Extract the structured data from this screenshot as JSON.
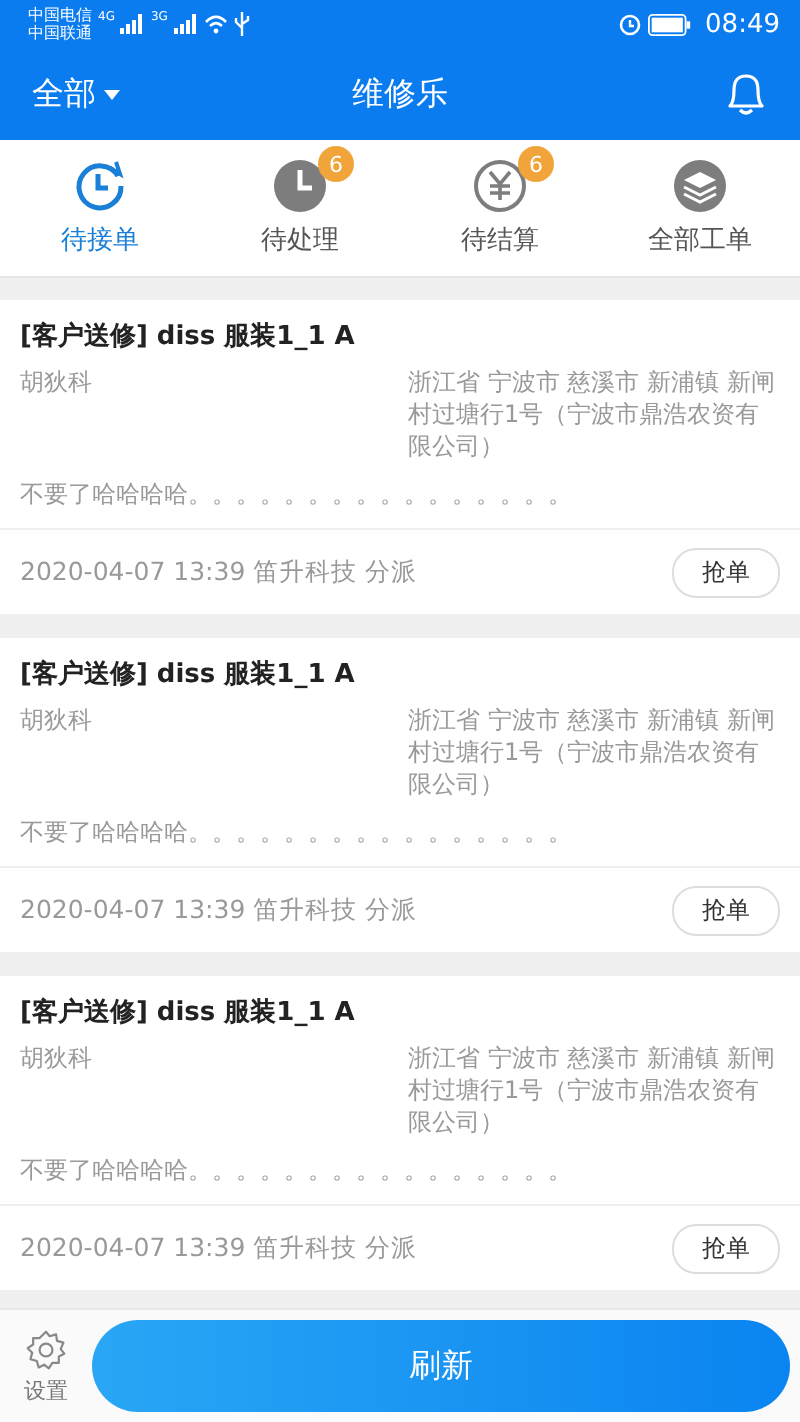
{
  "status_bar": {
    "carriers": [
      "中国电信",
      "中国联通"
    ],
    "networks": [
      "4G",
      "3G"
    ],
    "time": "08:49"
  },
  "header": {
    "filter": "全部",
    "title": "维修乐"
  },
  "tabs": [
    {
      "label": "待接单",
      "kind": "clock",
      "selected": true
    },
    {
      "label": "待处理",
      "kind": "pie",
      "badge": "6",
      "selected": false
    },
    {
      "label": "待结算",
      "kind": "yen",
      "badge": "6",
      "selected": false
    },
    {
      "label": "全部工单",
      "kind": "layers",
      "selected": false
    }
  ],
  "orders": [
    {
      "title": "[客户送修] diss 服装1_1 A",
      "customer": "胡狄科",
      "address": "浙江省 宁波市 慈溪市 新浦镇 新闸村过塘行1号（宁波市鼎浩农资有限公司）",
      "note": "不要了哈哈哈哈。。。。。。。。。。。。。。。。",
      "footer": "2020-04-07 13:39 笛升科技 分派",
      "action": "抢单"
    },
    {
      "title": "[客户送修] diss 服装1_1 A",
      "customer": "胡狄科",
      "address": "浙江省 宁波市 慈溪市 新浦镇 新闸村过塘行1号（宁波市鼎浩农资有限公司）",
      "note": "不要了哈哈哈哈。。。。。。。。。。。。。。。。",
      "footer": "2020-04-07 13:39 笛升科技 分派",
      "action": "抢单"
    },
    {
      "title": "[客户送修] diss 服装1_1 A",
      "customer": "胡狄科",
      "address": "浙江省 宁波市 慈溪市 新浦镇 新闸村过塘行1号（宁波市鼎浩农资有限公司）",
      "note": "不要了哈哈哈哈。。。。。。。。。。。。。。。。",
      "footer": "2020-04-07 13:39 笛升科技 分派",
      "action": "抢单"
    }
  ],
  "bottom_bar": {
    "settings": "设置",
    "refresh": "刷新"
  }
}
